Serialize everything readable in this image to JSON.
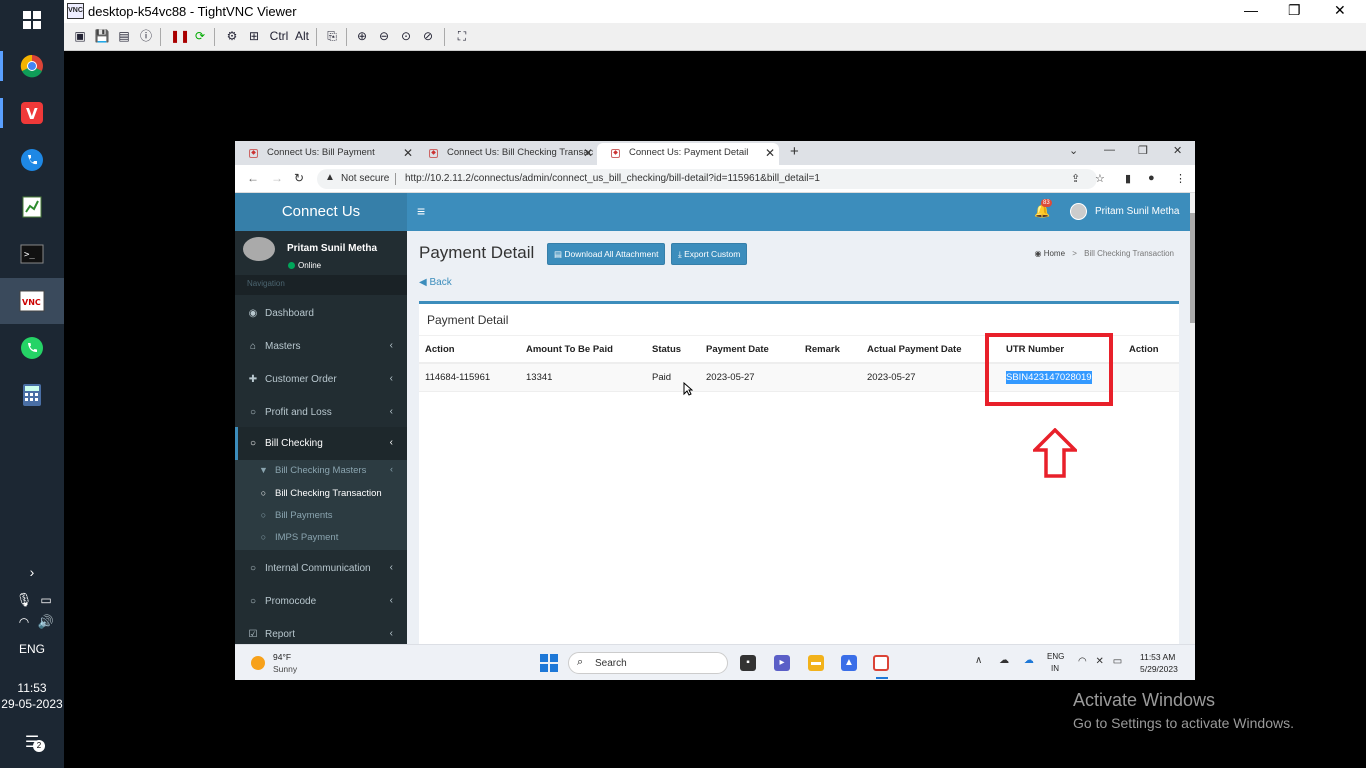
{
  "vnc": {
    "title": "desktop-k54vc88 - TightVNC Viewer",
    "logo": "VNC"
  },
  "host_taskbar": {
    "lang": "ENG",
    "time": "11:53",
    "date": "29-05-2023",
    "notif_count": "2"
  },
  "browser": {
    "tabs": [
      {
        "label": "Connect Us: Bill Payment"
      },
      {
        "label": "Connect Us: Bill Checking Transac"
      },
      {
        "label": "Connect Us: Payment Detail"
      }
    ],
    "not_secure": "Not secure",
    "url": "http://10.2.11.2/connectus/admin/connect_us_bill_checking/bill-detail?id=115961&bill_detail=1"
  },
  "app": {
    "logo": "Connect Us",
    "notif_badge": "83",
    "user": "Pritam Sunil Metha",
    "online": "Online",
    "nav_label": "Navigation",
    "menu": [
      {
        "label": "Dashboard"
      },
      {
        "label": "Masters"
      },
      {
        "label": "Customer Order"
      },
      {
        "label": "Profit and Loss"
      },
      {
        "label": "Bill Checking"
      },
      {
        "label": "Internal Communication"
      },
      {
        "label": "Promocode"
      },
      {
        "label": "Report"
      }
    ],
    "submenu": [
      {
        "label": "Bill Checking Masters"
      },
      {
        "label": "Bill Checking Transaction"
      },
      {
        "label": "Bill Payments"
      },
      {
        "label": "IMPS Payment"
      }
    ],
    "page_title": "Payment Detail",
    "btn_download": "Download All Attachment",
    "btn_export": "Export Custom",
    "breadcrumb": {
      "home": "Home",
      "sep": ">",
      "current": "Bill Checking Transaction"
    },
    "back": "Back",
    "box_title": "Payment Detail",
    "table": {
      "headers": [
        "Action",
        "Amount To Be Paid",
        "Status",
        "Payment Date",
        "Remark",
        "Actual Payment Date",
        "UTR Number",
        "Action"
      ],
      "rows": [
        {
          "action": "114684-115961",
          "amount": "13341",
          "status": "Paid",
          "payment_date": "2023-05-27",
          "remark": "",
          "actual_date": "2023-05-27",
          "utr": "SBIN423147028019",
          "action2": ""
        }
      ]
    }
  },
  "remote_taskbar": {
    "temp": "94°F",
    "condition": "Sunny",
    "search": "Search",
    "lang1": "ENG",
    "lang2": "IN",
    "time": "11:53 AM",
    "date": "5/29/2023"
  },
  "activate": {
    "line1": "Activate Windows",
    "line2": "Go to Settings to activate Windows."
  },
  "colors": {
    "accent": "#3c8dbc",
    "sidebar": "#222d32",
    "highlight": "#e8202a",
    "selection": "#3399ff"
  }
}
